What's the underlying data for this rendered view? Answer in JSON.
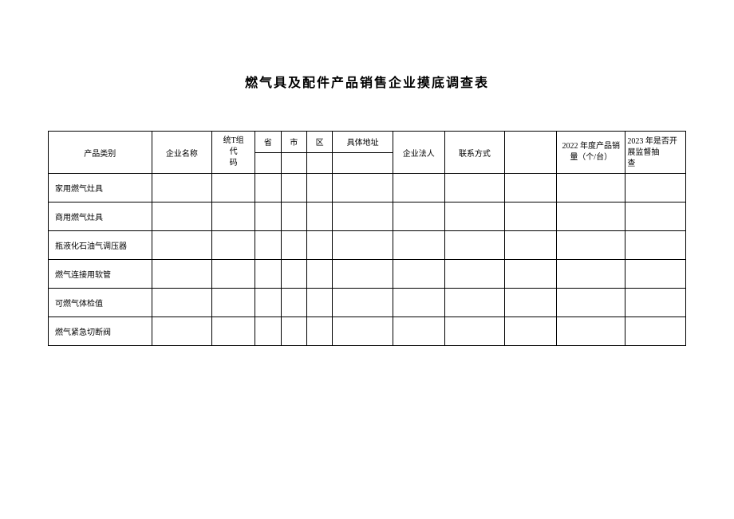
{
  "title": "燃气具及配件产品销售企业摸底调查表",
  "headers": {
    "category": "产品类别",
    "company_name": "企业名称",
    "code_line1": "统T组",
    "code_line2": "代",
    "code_line3": "码",
    "province": "省",
    "city": "市",
    "district": "区",
    "address": "具体地址",
    "legal_person": "企业法人",
    "contact": "联系方式",
    "sales_line1": "2022 年度产品销",
    "sales_line2": "量（个/台）",
    "inspect_line1": "2023 年是否开",
    "inspect_line2": "展监督抽",
    "inspect_line3": "查"
  },
  "rows": [
    {
      "label": "家用燃气灶具"
    },
    {
      "label": "商用燃气灶具"
    },
    {
      "label": "瓶液化石油气调压器"
    },
    {
      "label": "燃气连接用软管"
    },
    {
      "label": "可燃气体检值"
    },
    {
      "label": "燃气紧急切断阀"
    }
  ]
}
